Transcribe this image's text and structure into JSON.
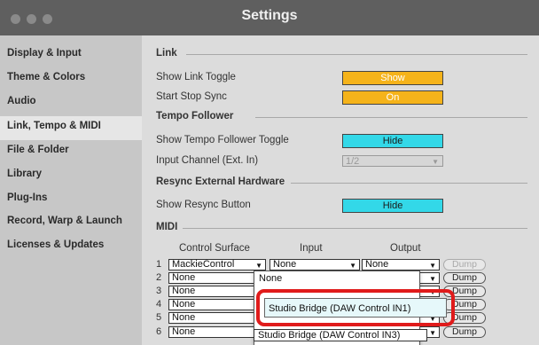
{
  "window": {
    "title": "Settings"
  },
  "sidebar": {
    "items": [
      {
        "label": "Display & Input"
      },
      {
        "label": "Theme & Colors"
      },
      {
        "label": "Audio"
      },
      {
        "label": "Link, Tempo & MIDI"
      },
      {
        "label": "File & Folder"
      },
      {
        "label": "Library"
      },
      {
        "label": "Plug-Ins"
      },
      {
        "label": "Record, Warp & Launch"
      },
      {
        "label": "Licenses & Updates"
      }
    ],
    "active_index": 3
  },
  "link": {
    "heading": "Link",
    "show_toggle_label": "Show Link Toggle",
    "show_toggle_value": "Show",
    "start_stop_label": "Start Stop Sync",
    "start_stop_value": "On"
  },
  "tempo": {
    "heading": "Tempo Follower",
    "show_toggle_label": "Show Tempo Follower Toggle",
    "show_toggle_value": "Hide",
    "input_channel_label": "Input Channel (Ext. In)",
    "input_channel_value": "1/2"
  },
  "resync": {
    "heading": "Resync External Hardware",
    "button_label": "Show Resync Button",
    "button_value": "Hide"
  },
  "midi": {
    "heading": "MIDI",
    "col_surface": "Control Surface",
    "col_input": "Input",
    "col_output": "Output",
    "dump_label": "Dump",
    "rows": [
      {
        "num": "1",
        "surface": "MackieControl",
        "input": "None",
        "output": "None"
      },
      {
        "num": "2",
        "surface": "None",
        "input": "None",
        "output": ""
      },
      {
        "num": "3",
        "surface": "None",
        "input": "",
        "output": ""
      },
      {
        "num": "4",
        "surface": "None",
        "input": "",
        "output": ""
      },
      {
        "num": "5",
        "surface": "None",
        "input": "",
        "output": ""
      },
      {
        "num": "6",
        "surface": "None",
        "input": "Studio Bridge (DAW Control IN3)",
        "output": ""
      }
    ]
  },
  "popup": {
    "options": [
      "None"
    ],
    "highlighted": "Studio Bridge (DAW Control IN1)"
  },
  "colors": {
    "accent_orange": "#f5b31a",
    "accent_cyan": "#33d8e8",
    "highlight_red": "#e01b1b"
  }
}
